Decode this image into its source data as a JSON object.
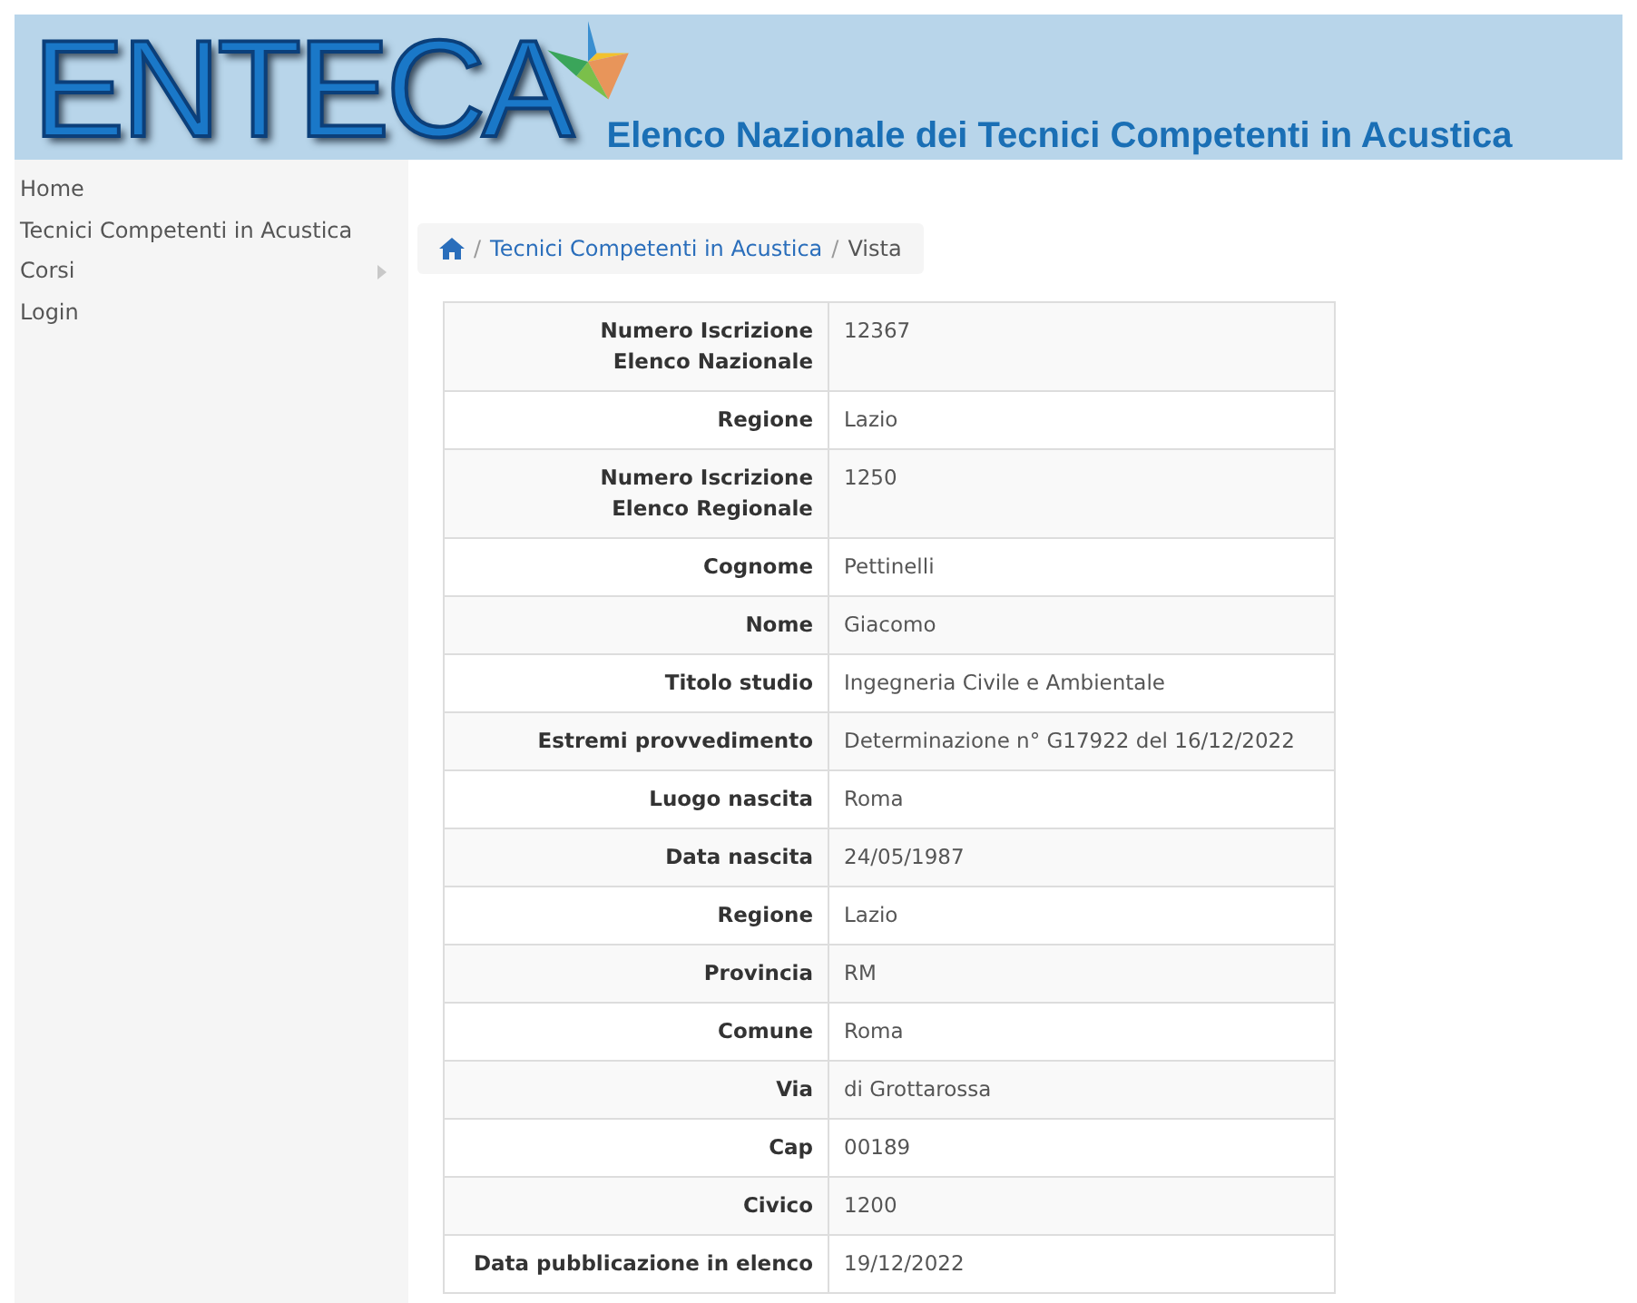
{
  "header": {
    "logo": "ENTECA",
    "subtitle": "Elenco Nazionale dei Tecnici Competenti in Acustica"
  },
  "sidebar": {
    "items": [
      {
        "label": "Home",
        "has_submenu": false
      },
      {
        "label": "Tecnici Competenti in Acustica",
        "has_submenu": false
      },
      {
        "label": "Corsi",
        "has_submenu": true
      },
      {
        "label": "Login",
        "has_submenu": false
      }
    ]
  },
  "breadcrumb": {
    "separator": "/",
    "items": [
      "Tecnici Competenti in Acustica",
      "Vista"
    ]
  },
  "details": [
    {
      "label": "Numero Iscrizione\nElenco Nazionale",
      "value": "12367"
    },
    {
      "label": "Regione",
      "value": "Lazio"
    },
    {
      "label": "Numero Iscrizione\nElenco Regionale",
      "value": "1250"
    },
    {
      "label": "Cognome",
      "value": "Pettinelli"
    },
    {
      "label": "Nome",
      "value": "Giacomo"
    },
    {
      "label": "Titolo studio",
      "value": "Ingegneria Civile e Ambientale"
    },
    {
      "label": "Estremi provvedimento",
      "value": "Determinazione n° G17922 del 16/12/2022"
    },
    {
      "label": "Luogo nascita",
      "value": "Roma"
    },
    {
      "label": "Data nascita",
      "value": "24/05/1987"
    },
    {
      "label": "Regione",
      "value": "Lazio"
    },
    {
      "label": "Provincia",
      "value": "RM"
    },
    {
      "label": "Comune",
      "value": "Roma"
    },
    {
      "label": "Via",
      "value": "di Grottarossa"
    },
    {
      "label": "Cap",
      "value": "00189"
    },
    {
      "label": "Civico",
      "value": "1200"
    },
    {
      "label": "Data pubblicazione in elenco",
      "value": "19/12/2022"
    }
  ]
}
